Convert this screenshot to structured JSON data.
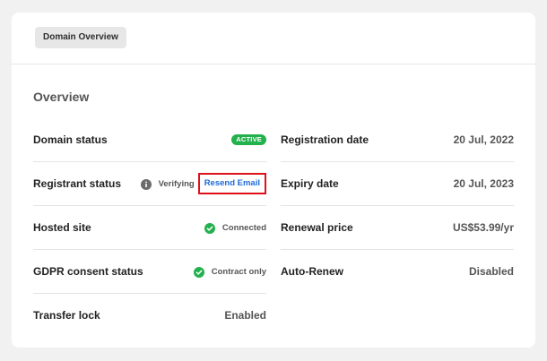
{
  "tab": {
    "label": "Domain Overview"
  },
  "overview": {
    "title": "Overview",
    "left_rows": [
      {
        "label": "Domain status",
        "badge": "ACTIVE",
        "badge_color": "#23b14d"
      },
      {
        "label": "Registrant status",
        "status": "Verifying",
        "status_icon": "info-icon",
        "action": "Resend Email"
      },
      {
        "label": "Hosted site",
        "status": "Connected",
        "status_icon": "check-circle-icon"
      },
      {
        "label": "GDPR consent status",
        "status": "Contract only",
        "status_icon": "check-circle-icon"
      },
      {
        "label": "Transfer lock",
        "value": "Enabled"
      }
    ],
    "right_rows": [
      {
        "label": "Registration date",
        "value": "20 Jul, 2022"
      },
      {
        "label": "Expiry date",
        "value": "20 Jul, 2023"
      },
      {
        "label": "Renewal price",
        "value": "US$53.99/yr"
      },
      {
        "label": "Auto-Renew",
        "value": "Disabled"
      }
    ]
  },
  "colors": {
    "success": "#23b14d",
    "link": "#1e6ad8",
    "highlight": "#e0101a",
    "info_icon": "#6b6b6b"
  }
}
